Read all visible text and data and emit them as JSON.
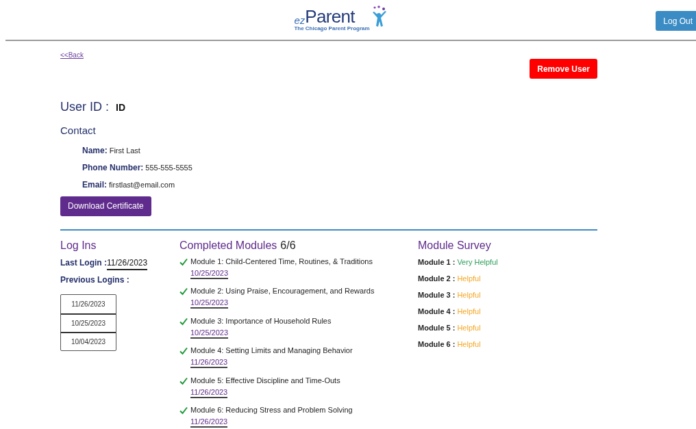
{
  "header": {
    "logo": {
      "prefix": "ez",
      "name": "Parent",
      "tagline": "The Chicago Parent Program"
    },
    "logout_button": "Log Out"
  },
  "back_link": "<<Back",
  "remove_button": "Remove User",
  "user_id": {
    "label": "User ID :",
    "value": "ID"
  },
  "contact": {
    "title": "Contact",
    "fields": [
      {
        "label": "Name:",
        "value": "First Last"
      },
      {
        "label": "Phone Number:",
        "value": "555-555-5555"
      },
      {
        "label": "Email:",
        "value": "firstlast@email.com"
      }
    ]
  },
  "download_button": "Download Certificate",
  "log_ins": {
    "title": "Log Ins",
    "last_login_label": "Last Login :",
    "last_login": "11/26/2023",
    "previous_label": "Previous Logins :",
    "previous": [
      "11/26/2023",
      "10/25/2023",
      "10/04/2023"
    ]
  },
  "completed_modules": {
    "title": "Completed Modules",
    "count": "6/6",
    "modules": [
      {
        "title": "Module 1: Child-Centered Time, Routines, & Traditions",
        "date": "10/25/2023",
        "completed": true
      },
      {
        "title": "Module 2: Using Praise, Encouragement, and Rewards",
        "date": "10/25/2023",
        "completed": true
      },
      {
        "title": "Module 3: Importance of Household Rules",
        "date": "10/25/2023",
        "completed": true
      },
      {
        "title": "Module 4: Setting Limits and Managing Behavior",
        "date": "11/26/2023",
        "completed": true
      },
      {
        "title": "Module 5: Effective Discipline and Time-Outs",
        "date": "11/26/2023",
        "completed": true
      },
      {
        "title": "Module 6: Reducing Stress and Problem Solving",
        "date": "11/26/2023",
        "completed": true
      }
    ]
  },
  "module_survey": {
    "title": "Module Survey",
    "ratings": [
      {
        "label": "Module 1 :",
        "rating": "Very Helpful",
        "color": "#2e9e5b"
      },
      {
        "label": "Module 2 :",
        "rating": "Helpful",
        "color": "#f5a623"
      },
      {
        "label": "Module 3 :",
        "rating": "Helpful",
        "color": "#f5a623"
      },
      {
        "label": "Module 4 :",
        "rating": "Helpful",
        "color": "#f5a623"
      },
      {
        "label": "Module 5 :",
        "rating": "Helpful",
        "color": "#f5a623"
      },
      {
        "label": "Module 6 :",
        "rating": "Helpful",
        "color": "#f5a623"
      }
    ]
  }
}
